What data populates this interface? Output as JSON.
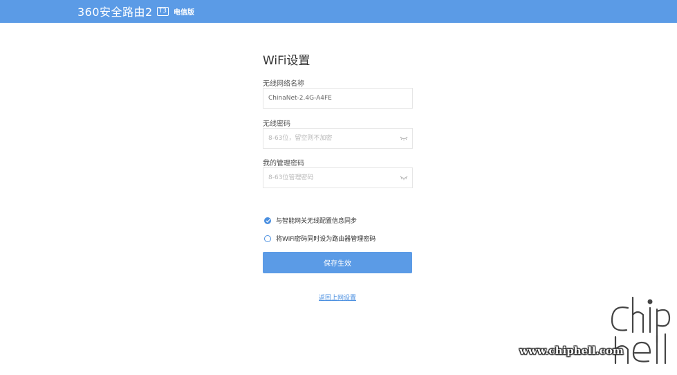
{
  "header": {
    "brand": "360安全路由2",
    "model_badge": "T3",
    "edition": "电信版"
  },
  "form": {
    "title": "WiFi设置",
    "ssid": {
      "label": "无线网络名称",
      "value": "ChinaNet-2.4G-A4FE"
    },
    "wifi_password": {
      "label": "无线密码",
      "placeholder": "8-63位，留空则不加密"
    },
    "admin_password": {
      "label": "我的管理密码",
      "placeholder": "8-63位管理密码"
    },
    "options": [
      {
        "label": "与智能网关无线配置信息同步",
        "checked": true
      },
      {
        "label": "将WiFi密码同时设为路由器管理密码",
        "checked": false
      }
    ],
    "save_label": "保存生效",
    "back_link": "返回上网设置"
  },
  "watermark": {
    "text": "chip hell",
    "url": "www.chiphell.com"
  },
  "colors": {
    "header_bg": "#5b9be6",
    "accent": "#4a8fe0"
  }
}
